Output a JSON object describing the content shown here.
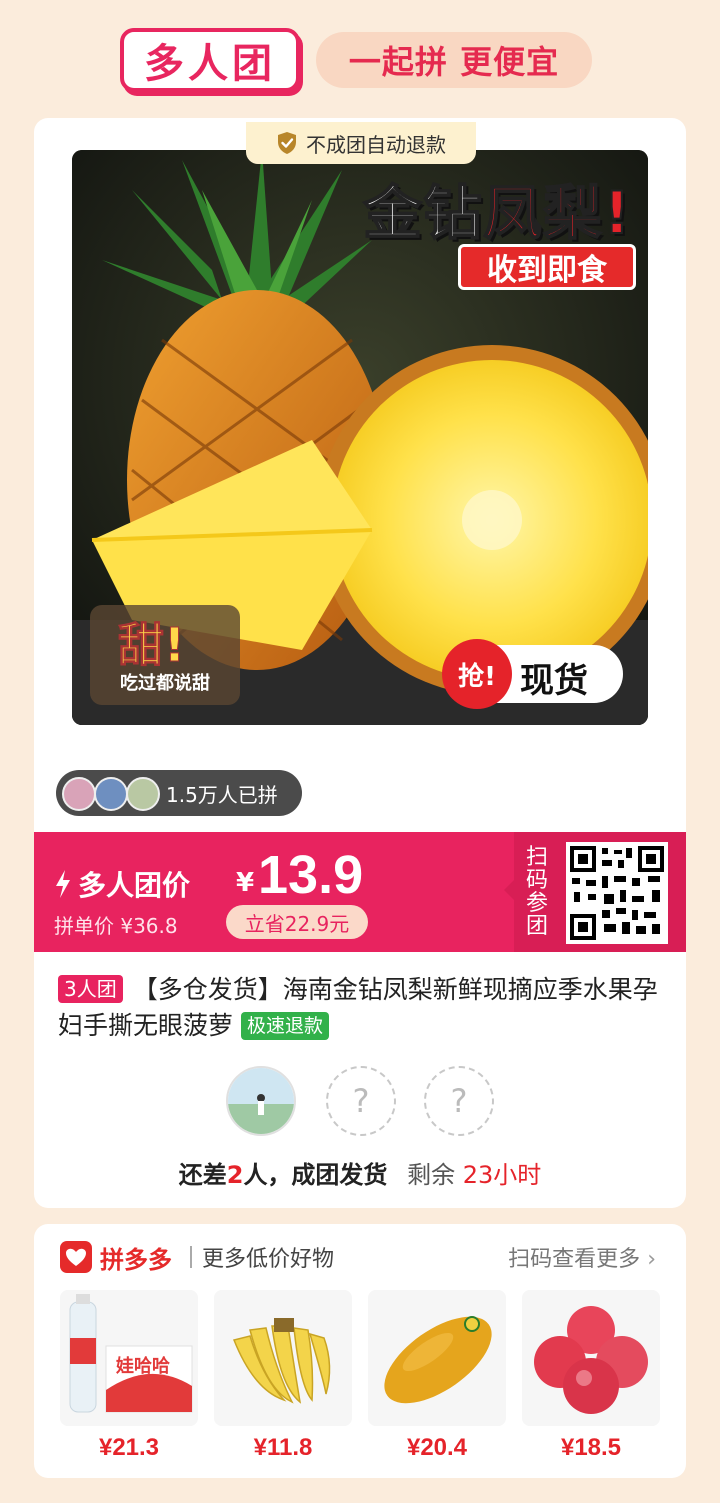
{
  "header": {
    "brand": "多人团",
    "slogan": "一起拼 更便宜"
  },
  "refund_tab": {
    "label": "不成团自动退款",
    "icon": "shield-check-icon"
  },
  "product_image": {
    "title_white": "金钻",
    "title_red": "凤梨!",
    "tag": "收到即食",
    "sweet_big": "甜!",
    "sweet_small": "吃过都说甜",
    "stock_grab": "抢!",
    "stock_text": "现货"
  },
  "joined": {
    "count_text": "1.5万人已拼"
  },
  "price_bar": {
    "group_label": "多人团价",
    "currency": "¥",
    "price": "13.9",
    "single_price": "拼单价 ¥36.8",
    "save": "立省22.9元",
    "qr_label": "扫码参团",
    "color": "#e8235f"
  },
  "product": {
    "group_tag": "3人团",
    "title": "【多仓发货】海南金钻凤梨新鲜现摘应季水果孕妇手撕无眼菠萝",
    "refund_tag": "极速退款"
  },
  "members": {
    "empty_symbol": "?"
  },
  "status": {
    "prefix": "还差",
    "count": "2",
    "suffix": "人，成团发货",
    "remain_label": "剩余",
    "remain_value": "23小时"
  },
  "recommend": {
    "brand": "拼多多",
    "subtitle": "更多低价好物",
    "more": "扫码查看更多",
    "items": [
      {
        "name": "water-bottles",
        "price": "¥21.3"
      },
      {
        "name": "bananas",
        "price": "¥11.8"
      },
      {
        "name": "mango",
        "price": "¥20.4"
      },
      {
        "name": "apples",
        "price": "¥18.5"
      }
    ]
  }
}
